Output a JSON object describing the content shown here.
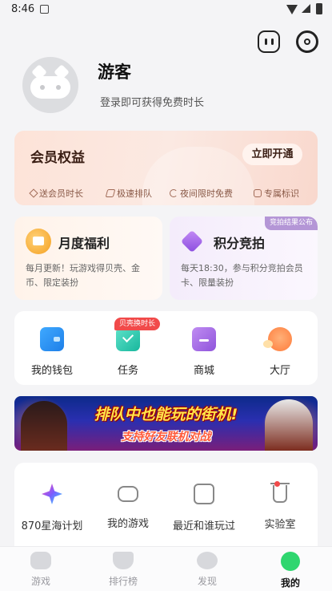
{
  "status_bar": {
    "time": "8:46"
  },
  "profile": {
    "name": "游客",
    "subtitle": "登录即可获得免费时长"
  },
  "vip": {
    "title": "会员权益",
    "button": "立即开通",
    "perks": [
      "送会员时长",
      "极速排队",
      "夜间限时免费",
      "专属标识"
    ]
  },
  "cards": {
    "monthly": {
      "title": "月度福利",
      "desc": "每月更新！玩游戏得贝壳、金币、限定装扮"
    },
    "points": {
      "title": "积分竞拍",
      "tag": "竞拍结果公布",
      "desc": "每天18:30，参与积分竞拍会员卡、限量装扮"
    }
  },
  "quick": {
    "badge": "贝壳换时长",
    "items": [
      "我的钱包",
      "任务",
      "商城",
      "大厅"
    ]
  },
  "banner": {
    "line1": "排队中也能玩的街机!",
    "line2": "支持好友联机对战"
  },
  "tools": [
    "870星海计划",
    "我的游戏",
    "最近和谁玩过",
    "实验室"
  ],
  "tabs": [
    "游戏",
    "排行榜",
    "发现",
    "我的"
  ],
  "colors": {
    "accent_green": "#2fd66f",
    "badge_red": "#f14a4a",
    "vip_bg": "#fde3d8"
  }
}
